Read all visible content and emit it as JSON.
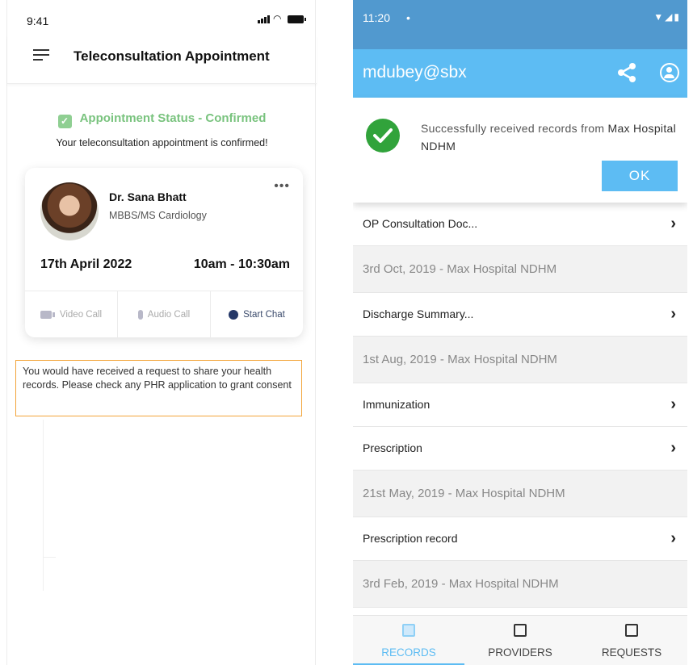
{
  "left": {
    "status_time": "9:41",
    "header_title": "Teleconsultation Appointment",
    "status_text": "Appointment Status - Confirmed",
    "confirmation_text": "Your teleconsultation appointment is confirmed!",
    "doctor": {
      "name": "Dr. Sana Bhatt",
      "specialty": "MBBS/MS Cardiology",
      "date": "17th April 2022",
      "time": "10am - 10:30am",
      "more": "•••"
    },
    "actions": {
      "video": "Video Call",
      "audio": "Audio Call",
      "chat": "Start Chat"
    },
    "consent_notice": "You would have received a request to share your health records. Please check any PHR application to grant consent",
    "colors": {
      "status_green": "#79c37e",
      "notice_border": "#f2a43a"
    }
  },
  "right": {
    "status_time": "11:20",
    "status_dot": "•",
    "user_id": "mdubey@sbx",
    "dialog": {
      "message_prefix": "Successfully received records from",
      "message_source": "Max Hospital NDHM",
      "ok_label": "OK"
    },
    "records": [
      {
        "label": "OP Consultation Doc...",
        "kind": "title"
      },
      {
        "label": "3rd Oct, 2019 - Max Hospital NDHM",
        "kind": "sub"
      },
      {
        "label": "Discharge Summary...",
        "kind": "title"
      },
      {
        "label": "1st Aug, 2019 - Max Hospital NDHM",
        "kind": "sub"
      },
      {
        "label": "Immunization",
        "kind": "title"
      },
      {
        "label": "Prescription",
        "kind": "title"
      },
      {
        "label": "21st May, 2019 - Max Hospital NDHM",
        "kind": "sub"
      },
      {
        "label": "Prescription record",
        "kind": "title"
      },
      {
        "label": "3rd Feb, 2019 - Max Hospital NDHM",
        "kind": "sub"
      }
    ],
    "nav": {
      "records": "RECORDS",
      "providers": "PROVIDERS",
      "requests": "REQUESTS"
    },
    "colors": {
      "appbar": "#5dbcf3",
      "statusbar": "#5199cf",
      "success": "#31a33b"
    }
  }
}
